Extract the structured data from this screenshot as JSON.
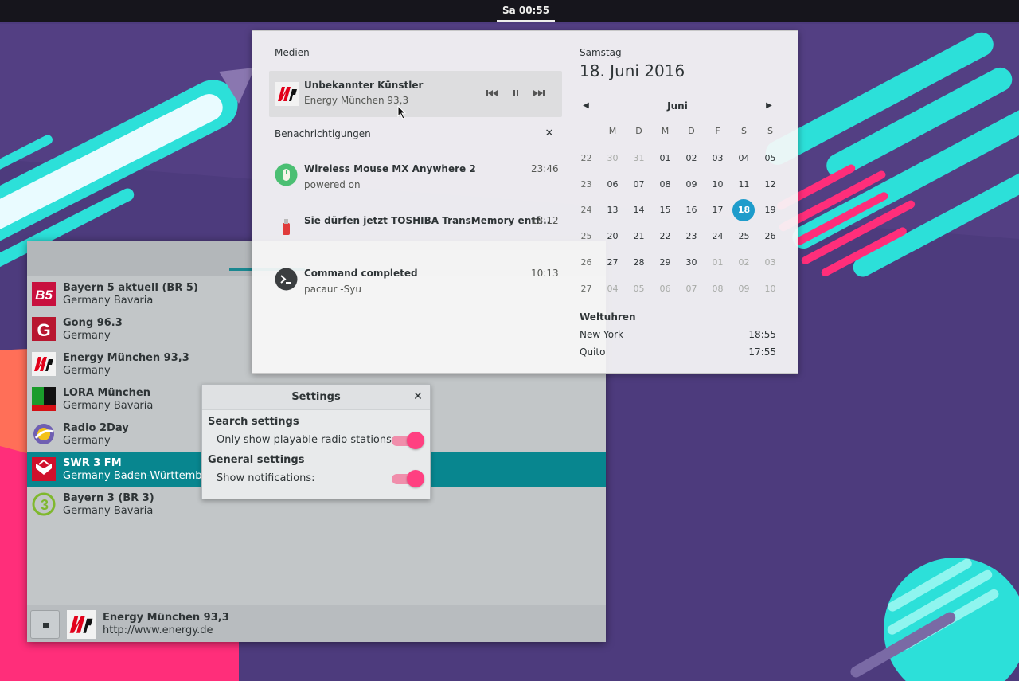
{
  "topbar": {
    "clock": "Sa 00:55"
  },
  "stations": [
    {
      "name": "Bayern 5 aktuell (BR 5)",
      "region": "Germany Bavaria",
      "logo": "b5-logo"
    },
    {
      "name": "Gong 96.3",
      "region": "Germany",
      "logo": "gong-logo"
    },
    {
      "name": "Energy München 93,3",
      "region": "Germany",
      "logo": "energy-logo"
    },
    {
      "name": "LORA München",
      "region": "Germany Bavaria",
      "logo": "lora-logo"
    },
    {
      "name": "Radio 2Day",
      "region": "Germany",
      "logo": "radio2day-logo"
    },
    {
      "name": "SWR 3 FM",
      "region": "Germany Baden-Württemberg",
      "logo": "swr3-logo",
      "selected": true
    },
    {
      "name": "Bayern 3 (BR 3)",
      "region": "Germany Bavaria",
      "logo": "bayern3-logo"
    }
  ],
  "player": {
    "station": "Energy München 93,3",
    "url": "http://www.energy.de"
  },
  "settings": {
    "title": "Settings",
    "search_heading": "Search settings",
    "playable_label": "Only show playable radio stations:",
    "playable_on": true,
    "general_heading": "General settings",
    "notifications_label": "Show notifications:",
    "notifications_on": true
  },
  "popover": {
    "media_title": "Medien",
    "media": {
      "artist": "Unbekannter Künstler",
      "station": "Energy München 93,3"
    },
    "notifications_title": "Benachrichtigungen",
    "notifications": [
      {
        "title": "Wireless Mouse MX Anywhere 2",
        "body": "powered on",
        "time": "23:46",
        "icon": "mouse-icon"
      },
      {
        "title": "Sie dürfen jetzt TOSHIBA TransMemory entf...",
        "body": "",
        "time": "18:12",
        "icon": "usb-drive-icon"
      },
      {
        "title": "Command completed",
        "body": "pacaur -Syu",
        "time": "10:13",
        "icon": "terminal-icon"
      }
    ],
    "calendar": {
      "weekday": "Samstag",
      "date": "18. Juni 2016",
      "month": "Juni",
      "day_headers": [
        "M",
        "D",
        "M",
        "D",
        "F",
        "S",
        "S"
      ],
      "weeks": [
        {
          "week": "22",
          "days": [
            "30",
            "31",
            "01",
            "02",
            "03",
            "04",
            "05"
          ]
        },
        {
          "week": "23",
          "days": [
            "06",
            "07",
            "08",
            "09",
            "10",
            "11",
            "12"
          ]
        },
        {
          "week": "24",
          "days": [
            "13",
            "14",
            "15",
            "16",
            "17",
            "18",
            "19"
          ]
        },
        {
          "week": "25",
          "days": [
            "20",
            "21",
            "22",
            "23",
            "24",
            "25",
            "26"
          ]
        },
        {
          "week": "26",
          "days": [
            "27",
            "28",
            "29",
            "30",
            "01",
            "02",
            "03"
          ]
        },
        {
          "week": "27",
          "days": [
            "04",
            "05",
            "06",
            "07",
            "08",
            "09",
            "10"
          ]
        }
      ],
      "today": "18"
    },
    "world_clocks_title": "Weltuhren",
    "world_clocks": [
      {
        "city": "New York",
        "time": "18:55"
      },
      {
        "city": "Quito",
        "time": "17:55"
      }
    ]
  },
  "colors": {
    "accent": "#08868f",
    "toggle": "#ff4081",
    "today": "#1e9ccb"
  }
}
